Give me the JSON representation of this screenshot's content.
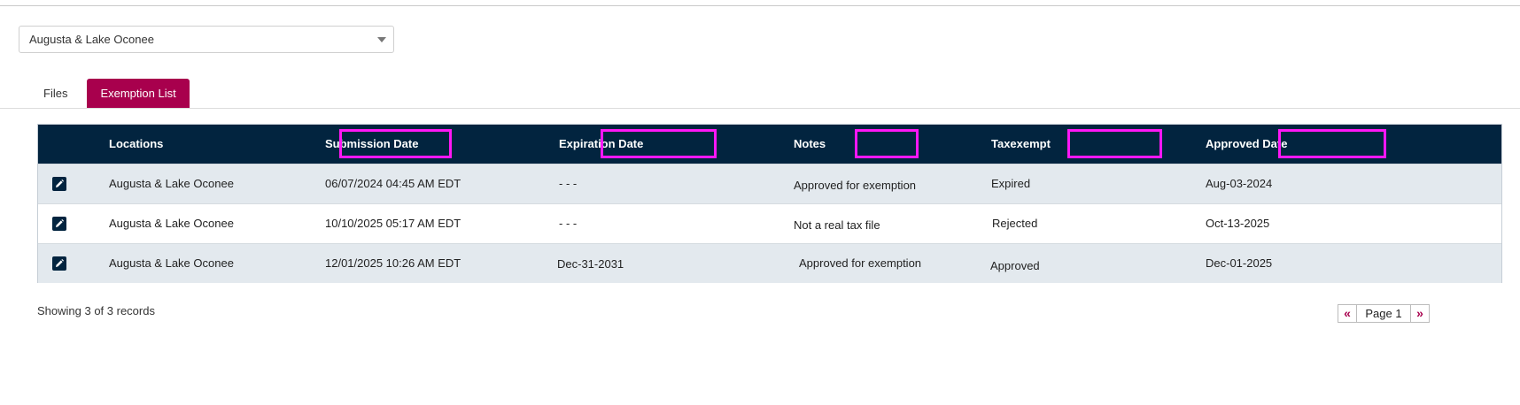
{
  "location_select": {
    "value": "Augusta & Lake Oconee"
  },
  "tabs": [
    {
      "label": "Files",
      "active": false
    },
    {
      "label": "Exemption List",
      "active": true
    }
  ],
  "table": {
    "headers": [
      "Locations",
      "Submission Date",
      "Expiration Date",
      "Notes",
      "Taxexempt",
      "Approved Date"
    ],
    "rows": [
      [
        "Augusta & Lake Oconee",
        "06/07/2024 04:45 AM EDT",
        "- - -",
        "Approved for exemption",
        "Expired",
        "Aug-03-2024"
      ],
      [
        "Augusta & Lake Oconee",
        "10/10/2025 05:17 AM EDT",
        "- - -",
        "Not a real tax file",
        "Rejected",
        "Oct-13-2025"
      ],
      [
        "Augusta & Lake Oconee",
        "12/01/2025 10:26 AM EDT",
        "Dec-31-2031",
        "Approved for exemption",
        "Approved",
        "Dec-01-2025"
      ]
    ]
  },
  "footer": {
    "records": "Showing 3 of 3 records",
    "page_label": "Page 1",
    "first_icon": "double-chevron-left-icon",
    "last_icon": "double-chevron-right-icon"
  },
  "colors": {
    "accent": "#a8004d",
    "header_bg": "#02243f",
    "highlight": "#ff17f7"
  }
}
